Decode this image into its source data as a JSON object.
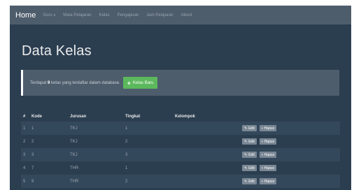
{
  "navbar": {
    "brand": "Home",
    "items": [
      {
        "label": "Guru",
        "dropdown": true
      },
      {
        "label": "Mata Pelajaran"
      },
      {
        "label": "Kelas"
      },
      {
        "label": "Pengajaran"
      },
      {
        "label": "Jam Pelajaran"
      },
      {
        "label": "About"
      }
    ]
  },
  "page": {
    "title": "Data Kelas"
  },
  "alert": {
    "prefix": "Terdapat",
    "count": "9",
    "suffix": "kelas yang terdaftar dalam database.",
    "button_label": "Kelas Baru"
  },
  "table": {
    "headers": {
      "num": "#",
      "kode": "Kode",
      "jurusan": "Jurusan",
      "tingkat": "Tingkat",
      "kelompok": "Kelompok"
    },
    "rows": [
      {
        "num": "1",
        "kode": "1",
        "jurusan": "TKJ",
        "tingkat": "1",
        "kelompok": ""
      },
      {
        "num": "2",
        "kode": "2",
        "jurusan": "TKJ",
        "tingkat": "2",
        "kelompok": ""
      },
      {
        "num": "3",
        "kode": "3",
        "jurusan": "TKJ",
        "tingkat": "3",
        "kelompok": ""
      },
      {
        "num": "4",
        "kode": "7",
        "jurusan": "THR",
        "tingkat": "1",
        "kelompok": ""
      },
      {
        "num": "5",
        "kode": "9",
        "jurusan": "THR",
        "tingkat": "2",
        "kelompok": ""
      }
    ],
    "edit_label": "Edit",
    "delete_label": "Hapus"
  },
  "icons": {
    "plus": "plus-icon",
    "edit": "edit-icon",
    "delete": "trash-icon",
    "caret": "caret-down-icon"
  },
  "colors": {
    "background": "#2b3e50",
    "navbar": "#4e5d6c",
    "success": "#5cb85c"
  }
}
